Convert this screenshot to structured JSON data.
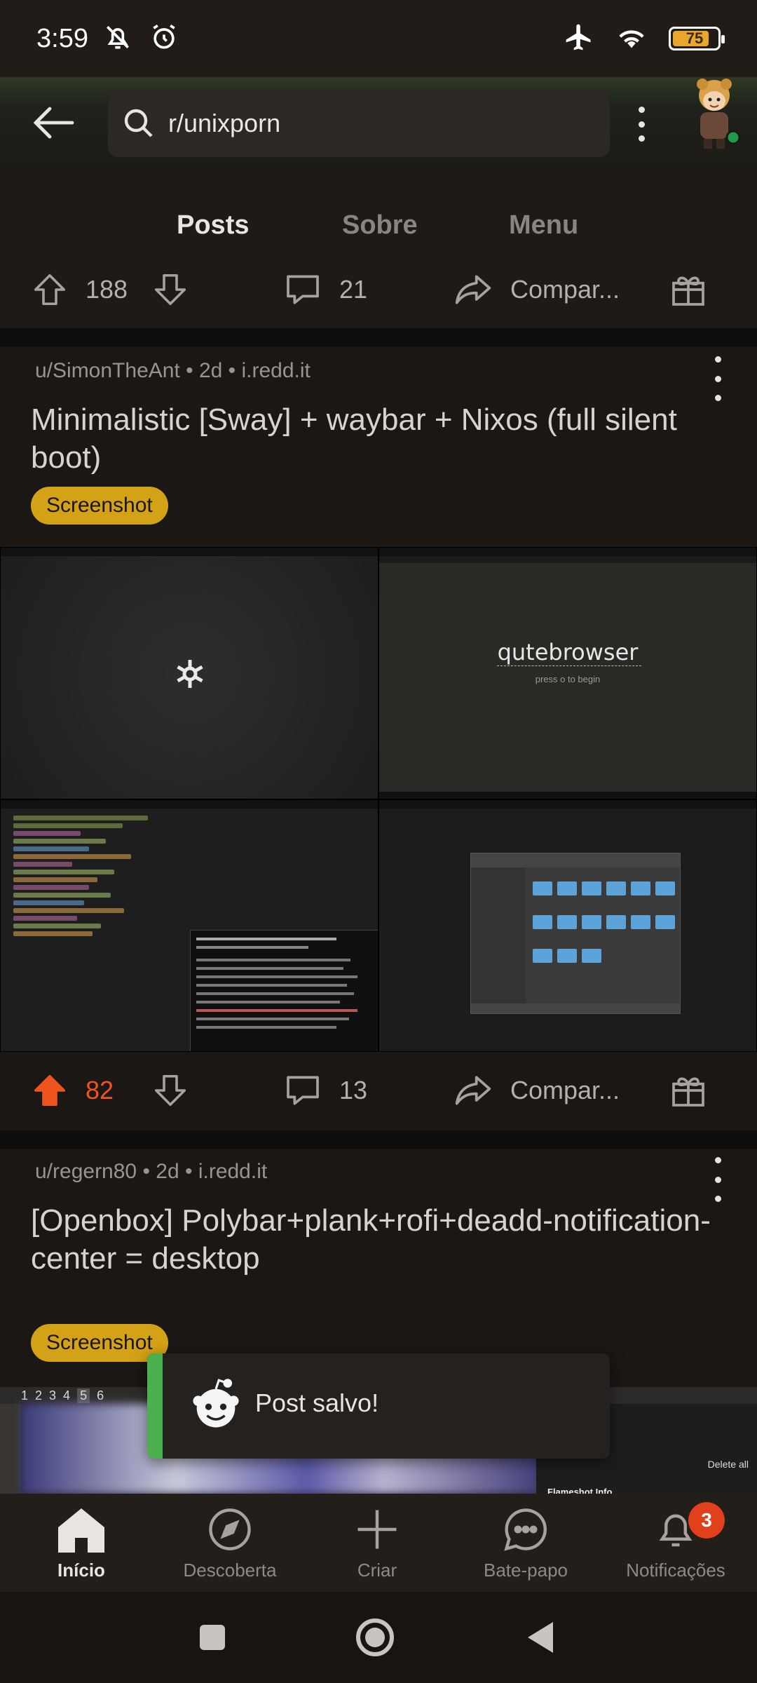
{
  "status_bar": {
    "time": "3:59",
    "battery": "75",
    "icons": [
      "mute-icon",
      "alarm-icon",
      "airplane-icon",
      "wifi-icon",
      "battery-icon"
    ]
  },
  "header": {
    "search_text": "r/unixporn",
    "back_icon": "arrow-left-icon",
    "menu_icon": "kebab-icon"
  },
  "tabs": [
    {
      "label": "Posts",
      "active": true
    },
    {
      "label": "Sobre",
      "active": false
    },
    {
      "label": "Menu",
      "active": false
    }
  ],
  "prev_post_actions": {
    "upvotes": "188",
    "comments": "21",
    "share": "Compar..."
  },
  "post1": {
    "meta": "u/SimonTheAnt • 2d • i.redd.it",
    "title": "Minimalistic [Sway] + waybar + Nixos (full silent boot)",
    "flair": "Screenshot",
    "image_text": {
      "browser_title": "qutebrowser",
      "browser_sub": "press o to begin"
    },
    "upvotes": "82",
    "comments": "13",
    "share": "Compar..."
  },
  "post2": {
    "meta": "u/regern80 • 2d • i.redd.it",
    "title": "[Openbox] Polybar+plank+rofi+deadd-notification-center = desktop",
    "flair": "Screenshot",
    "workspaces": [
      "1",
      "2",
      "3",
      "4",
      "5",
      "6"
    ],
    "panel_text": "Delete all",
    "panel_title": "Flameshot Info"
  },
  "toast": {
    "text": "Post salvo!"
  },
  "bottom_nav": [
    {
      "label": "Início",
      "icon": "home-icon",
      "active": true
    },
    {
      "label": "Descoberta",
      "icon": "compass-icon",
      "active": false
    },
    {
      "label": "Criar",
      "icon": "plus-icon",
      "active": false
    },
    {
      "label": "Bate-papo",
      "icon": "chat-icon",
      "active": false
    },
    {
      "label": "Notificações",
      "icon": "bell-icon",
      "active": false,
      "badge": "3"
    }
  ],
  "colors": {
    "accent": "#f0541e",
    "flair": "#d4a216",
    "tab_indicator": "#1a6fb5",
    "toast_accent": "#4caf50"
  }
}
